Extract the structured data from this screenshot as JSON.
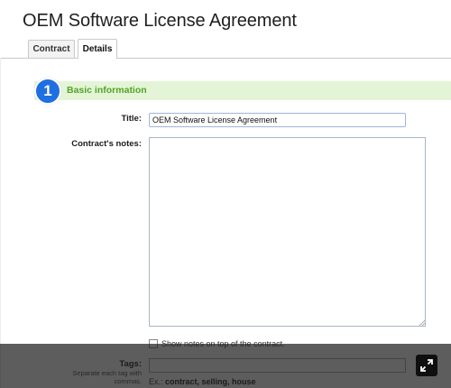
{
  "page": {
    "title": "OEM Software License Agreement"
  },
  "tabs": [
    {
      "label": "Contract",
      "active": false
    },
    {
      "label": "Details",
      "active": true
    }
  ],
  "section": {
    "step_number": "1",
    "title": "Basic information",
    "header_bg_color": "#e3f5d6",
    "header_text_color": "#56a22a",
    "badge_color": "#1f6fe0"
  },
  "form": {
    "title_label": "Title:",
    "title_value": "OEM Software License Agreement",
    "notes_label": "Contract's notes:",
    "notes_value": "",
    "show_notes_label": "Show notes on top of the contract.",
    "show_notes_checked": false,
    "tags_label": "Tags:",
    "tags_hint": "Separate each tag with commas.",
    "tags_value": "",
    "tags_example_prefix": "Ex.:",
    "tags_example_values": "contract, selling, house"
  },
  "overlay": {
    "expand_icon": "expand-arrows-icon"
  }
}
